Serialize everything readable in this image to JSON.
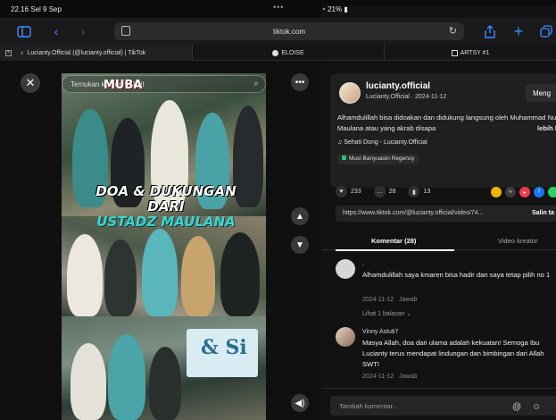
{
  "status": {
    "time": "22.16  Sel 9 Sep",
    "dots": "•••",
    "battery": "21%"
  },
  "browser": {
    "url": "tiktok.com",
    "tabs": [
      {
        "label": "Lucianty.Official (@lucianty.official) | TikTok"
      },
      {
        "label": "ELOISE"
      },
      {
        "label": "ARTSY #1"
      }
    ]
  },
  "video": {
    "search_placeholder": "Temukan konten terkait",
    "overlay_title_line1": "DOA & DUKUNGAN DARI",
    "overlay_title_line2": "USTADZ MAULANA",
    "logo_text": "MUBA",
    "banner_text": "& Si"
  },
  "post": {
    "username": "lucianty.official",
    "subline": "Lucianty.Official · 2024-11-12",
    "follow_label": "Meng",
    "caption": "Alhamdulillah bisa didoakan dan didukung langsung oleh Muhammad Nur Maulana atau yang akrab disapa",
    "caption_more": "lebih b",
    "music": "Sehati Dong - Lucianty.Official",
    "location": "Musi Banyuasin Regency",
    "likes": "233",
    "comments_count": "28",
    "saves": "13",
    "link": "https://www.tiktok.com/@lucianty.official/video/74...",
    "copy_label": "Salin ta"
  },
  "comment_tabs": {
    "comments": "Komentar (28)",
    "creator_videos": "Video kreator"
  },
  "comments": [
    {
      "name": ".",
      "text": "Alhamdulillah saya kmaren bisa hadir dan saya tetap pilih no 1",
      "date": "2024-11-12",
      "reply": "Jawab",
      "replies": "Lihat 1 balasan ⌄"
    },
    {
      "name": "Vinny Astuti7",
      "text": "Masya Allah, doa dari ulama adalah kekuatan! Semoga Ibu Lucianty terus mendapat lindungan dan bimbingan dari Allah SWT!",
      "date": "2024-11-12",
      "reply": "Jawab"
    }
  ],
  "compose": {
    "placeholder": "Tambah komentar..."
  },
  "colors": {
    "accent": "#3d8dff",
    "caption_cyan": "#3ed4cf",
    "location_green": "#21c77a"
  }
}
